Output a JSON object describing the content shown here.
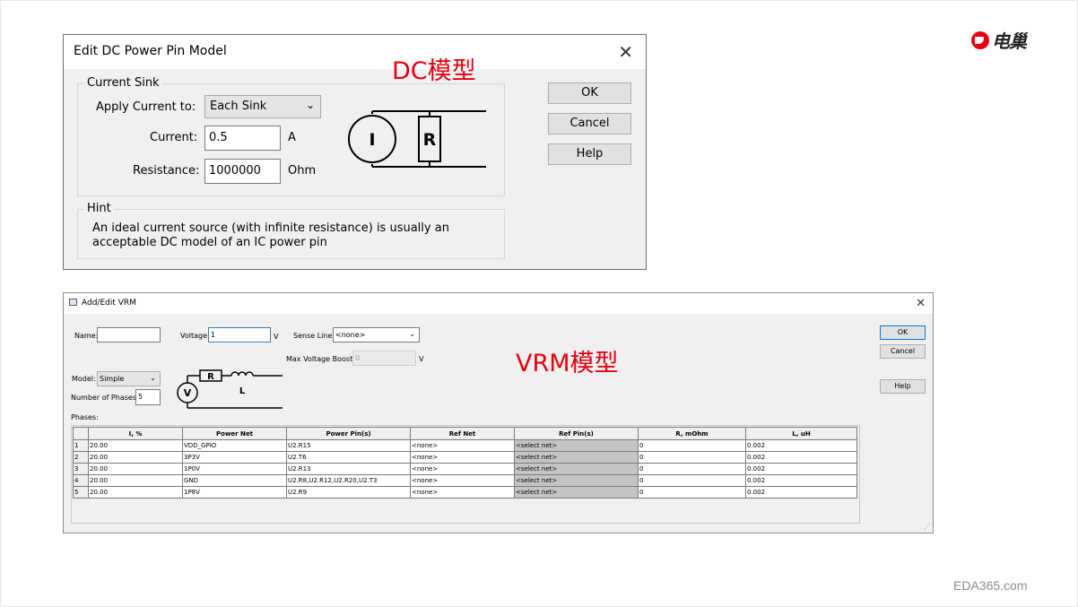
{
  "logo": {
    "text": "电巢"
  },
  "footer": {
    "site": "EDA365.com"
  },
  "labels": {
    "dc_model": "DC模型",
    "vrm_model": "VRM模型"
  },
  "dc_dialog": {
    "title": "Edit DC Power Pin Model",
    "current_sink": {
      "group_title": "Current Sink",
      "apply_label": "Apply Current to:",
      "apply_value": "Each Sink",
      "current_label": "Current:",
      "current_value": "0.5",
      "current_unit": "A",
      "resistance_label": "Resistance:",
      "resistance_value": "1000000",
      "resistance_unit": "Ohm"
    },
    "schematic": {
      "source_letter": "I",
      "resistor_letter": "R"
    },
    "hint": {
      "group_title": "Hint",
      "text": "An ideal current source (with infinite resistance) is usually an acceptable DC model of an IC power pin"
    },
    "buttons": {
      "ok": "OK",
      "cancel": "Cancel",
      "help": "Help"
    }
  },
  "vrm_dialog": {
    "title": "Add/Edit VRM",
    "name_label": "Name:",
    "name_value": "",
    "voltage_label": "Voltage:",
    "voltage_value": "1",
    "voltage_unit": "V",
    "sense_line_label": "Sense Line:",
    "sense_line_value": "<none>",
    "max_voltage_boost_label": "Max Voltage Boost:",
    "max_voltage_boost_value": "0",
    "max_voltage_boost_unit": "V",
    "model_label": "Model:",
    "model_value": "Simple",
    "phases_count_label": "Number of Phases:",
    "phases_count_value": "5",
    "phases_label": "Phases:",
    "schematic": {
      "source_letter": "V",
      "resistor_letter": "R",
      "inductor_letter": "L"
    },
    "buttons": {
      "ok": "OK",
      "cancel": "Cancel",
      "help": "Help"
    },
    "table": {
      "columns": [
        "",
        "I, %",
        "Power Net",
        "Power Pin(s)",
        "Ref Net",
        "Ref Pin(s)",
        "R, mOhm",
        "L, uH"
      ],
      "rows": [
        [
          "1",
          "20.00",
          "VDD_GPIO",
          "U2.R15",
          "<none>",
          "<select net>",
          "0",
          "0.002"
        ],
        [
          "2",
          "20.00",
          "3P3V",
          "U2.T6",
          "<none>",
          "<select net>",
          "0",
          "0.002"
        ],
        [
          "3",
          "20.00",
          "1P0V",
          "U2.R13",
          "<none>",
          "<select net>",
          "0",
          "0.002"
        ],
        [
          "4",
          "20.00",
          "GND",
          "U2.R8,U2.R12,U2.R20,U2.T3",
          "<none>",
          "<select net>",
          "0",
          "0.002"
        ],
        [
          "5",
          "20.00",
          "1P8V",
          "U2.R9",
          "<none>",
          "<select net>",
          "0",
          "0.002"
        ]
      ]
    }
  }
}
